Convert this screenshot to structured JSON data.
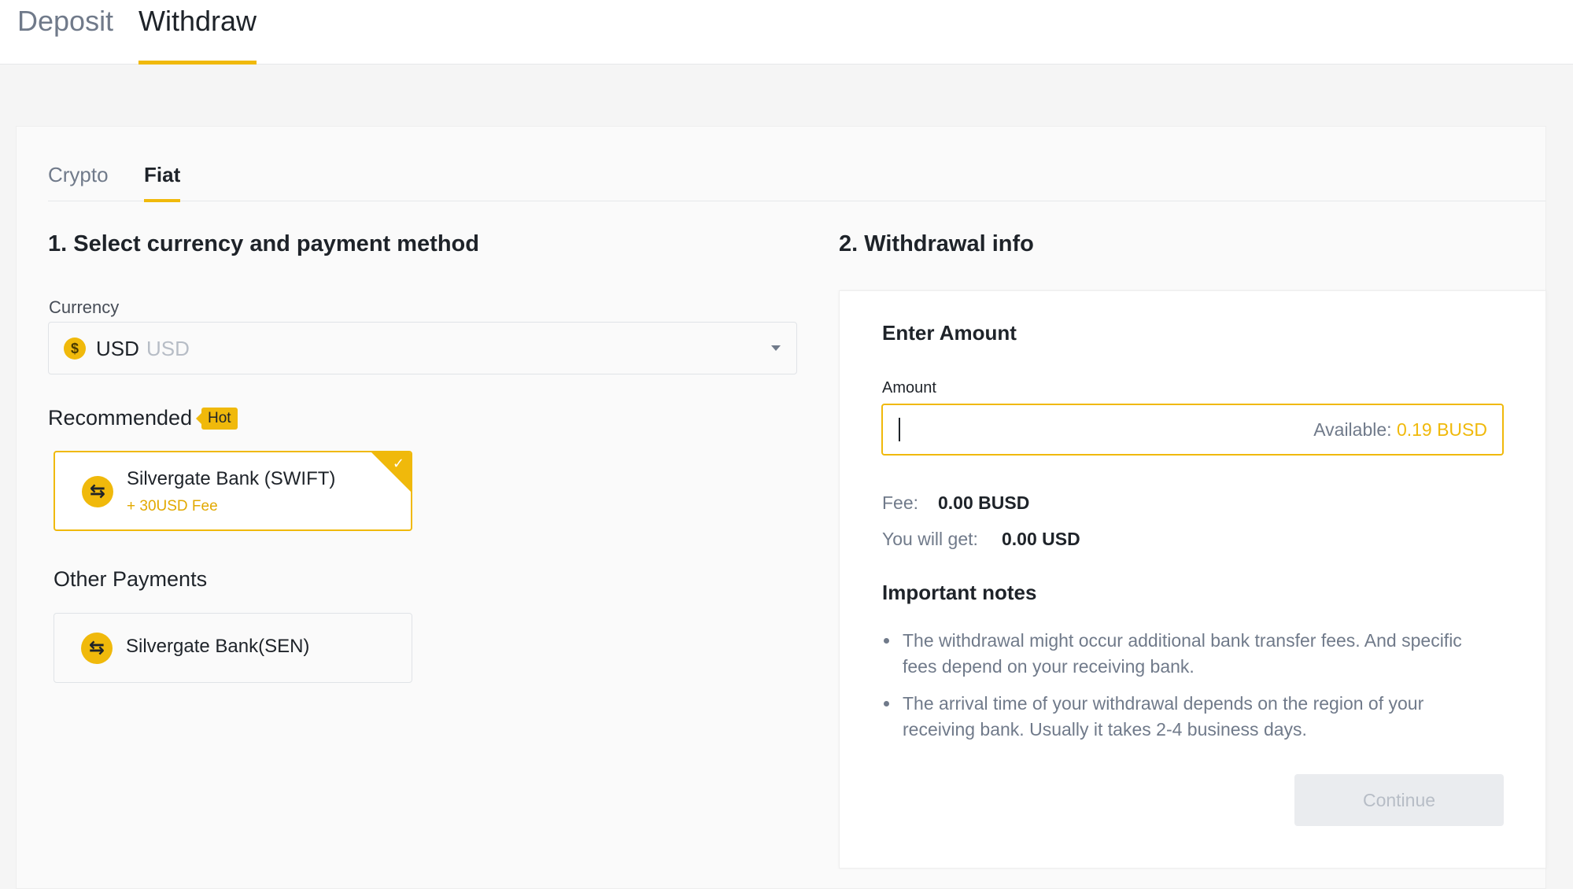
{
  "top_tabs": {
    "deposit": "Deposit",
    "withdraw": "Withdraw"
  },
  "sub_tabs": {
    "crypto": "Crypto",
    "fiat": "Fiat"
  },
  "left": {
    "section_title": "1. Select currency and payment method",
    "currency_label": "Currency",
    "currency_icon": "$",
    "currency_code": "USD",
    "currency_name": "USD",
    "recommended_label": "Recommended",
    "hot_badge": "Hot",
    "recommended_method": {
      "name": "Silvergate Bank (SWIFT)",
      "fee": "+ 30USD Fee",
      "icon": "⇆"
    },
    "other_label": "Other Payments",
    "other_method": {
      "name": "Silvergate Bank(SEN)",
      "icon": "⇆"
    }
  },
  "right": {
    "section_title": "2. Withdrawal info",
    "enter_amount": "Enter Amount",
    "amount_label": "Amount",
    "amount_value": "",
    "available_label": "Available:",
    "available_value": "0.19 BUSD",
    "fee_label": "Fee:",
    "fee_value": "0.00 BUSD",
    "get_label": "You will get:",
    "get_value": "0.00 USD",
    "notes_title": "Important notes",
    "notes": [
      "The withdrawal might occur additional bank transfer fees. And specific fees depend on your receiving bank.",
      "The arrival time of your withdrawal depends on the region of your receiving bank. Usually it takes 2-4 business days."
    ],
    "continue_label": "Continue"
  },
  "colors": {
    "accent": "#f0b90b",
    "text": "#1e2329",
    "muted": "#707a8a"
  }
}
